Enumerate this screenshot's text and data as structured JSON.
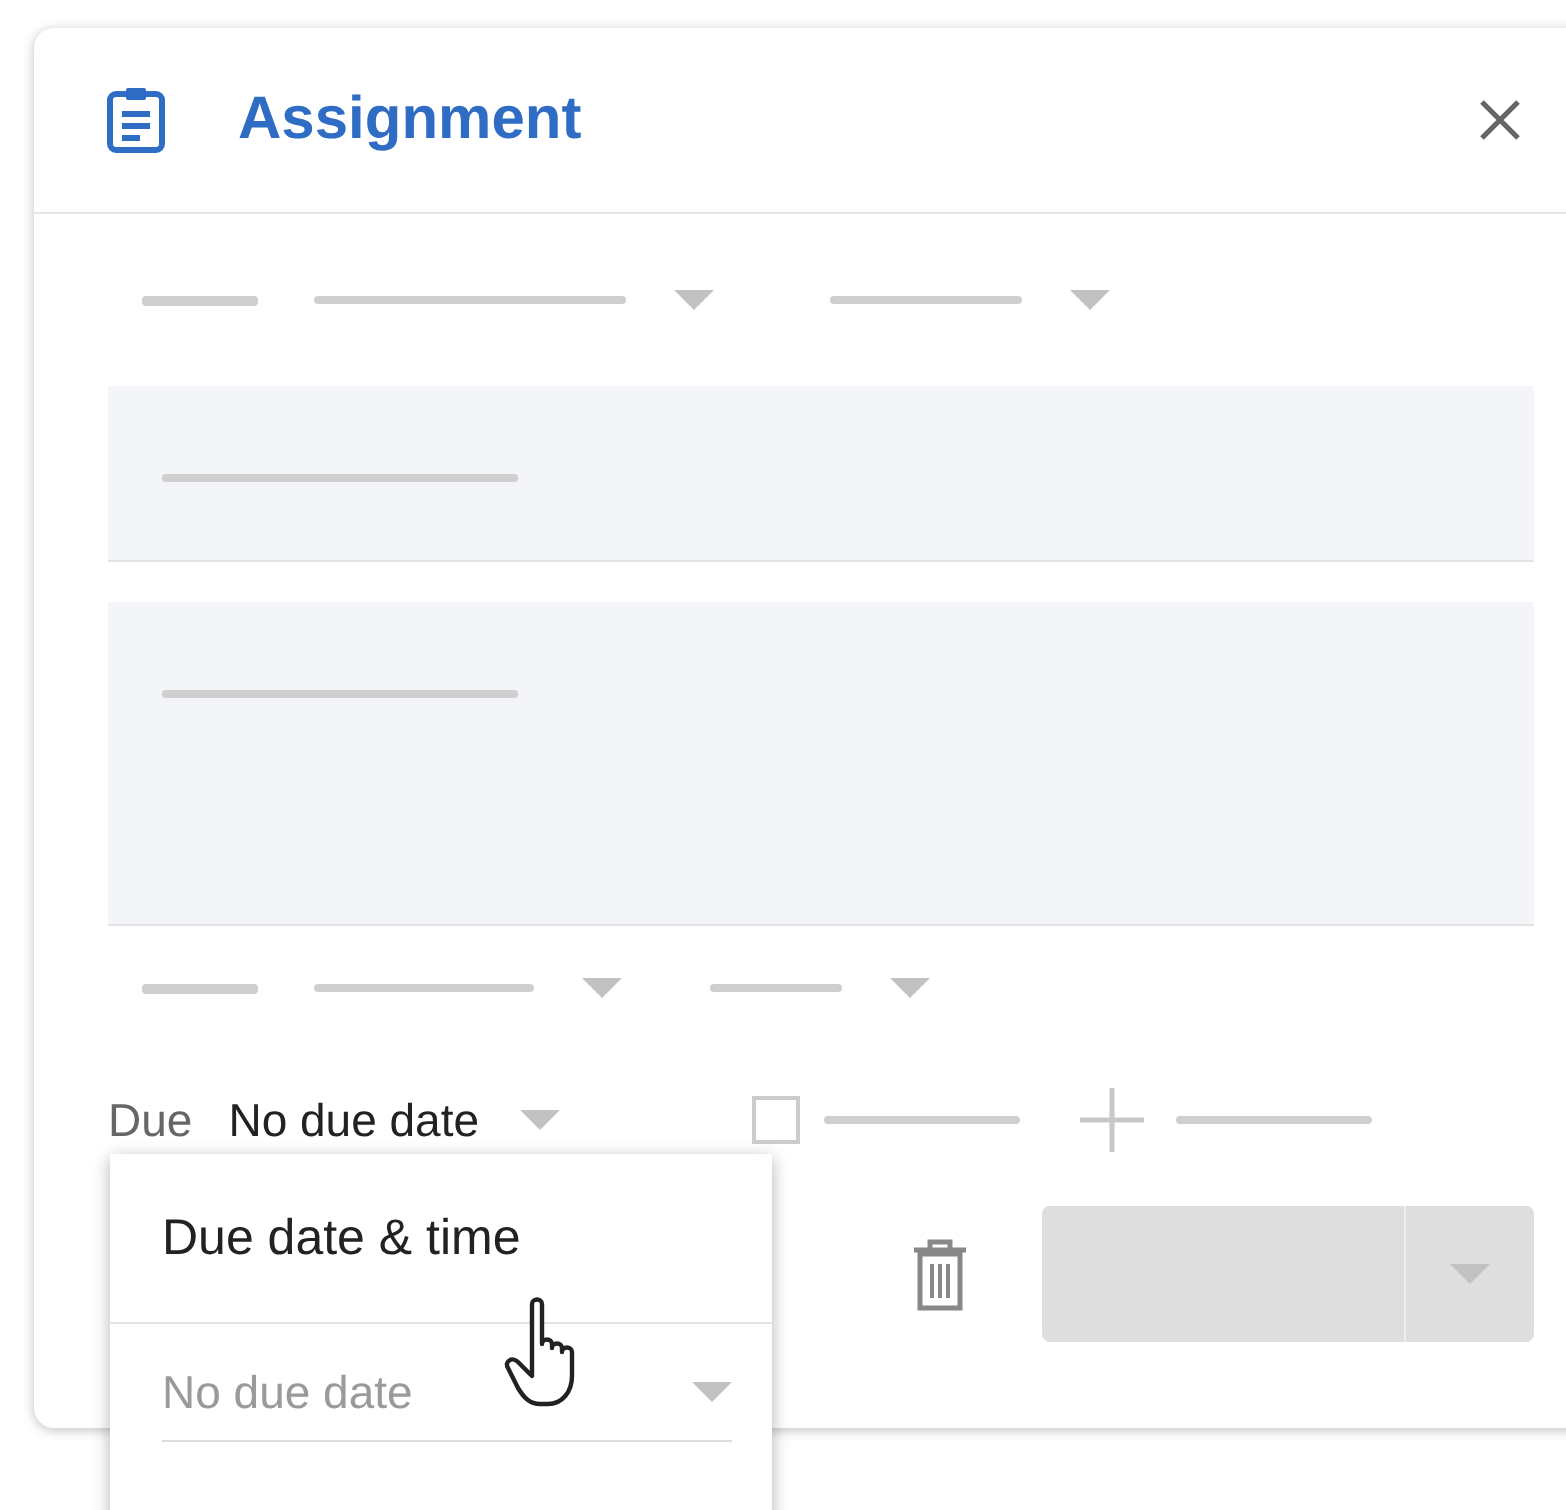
{
  "dialog": {
    "title": "Assignment"
  },
  "due": {
    "label": "Due",
    "value": "No due date"
  },
  "grading": {
    "checked": false
  },
  "due_menu": {
    "option": "Due date & time",
    "date_field": {
      "value": "No due date",
      "disabled": true
    }
  }
}
